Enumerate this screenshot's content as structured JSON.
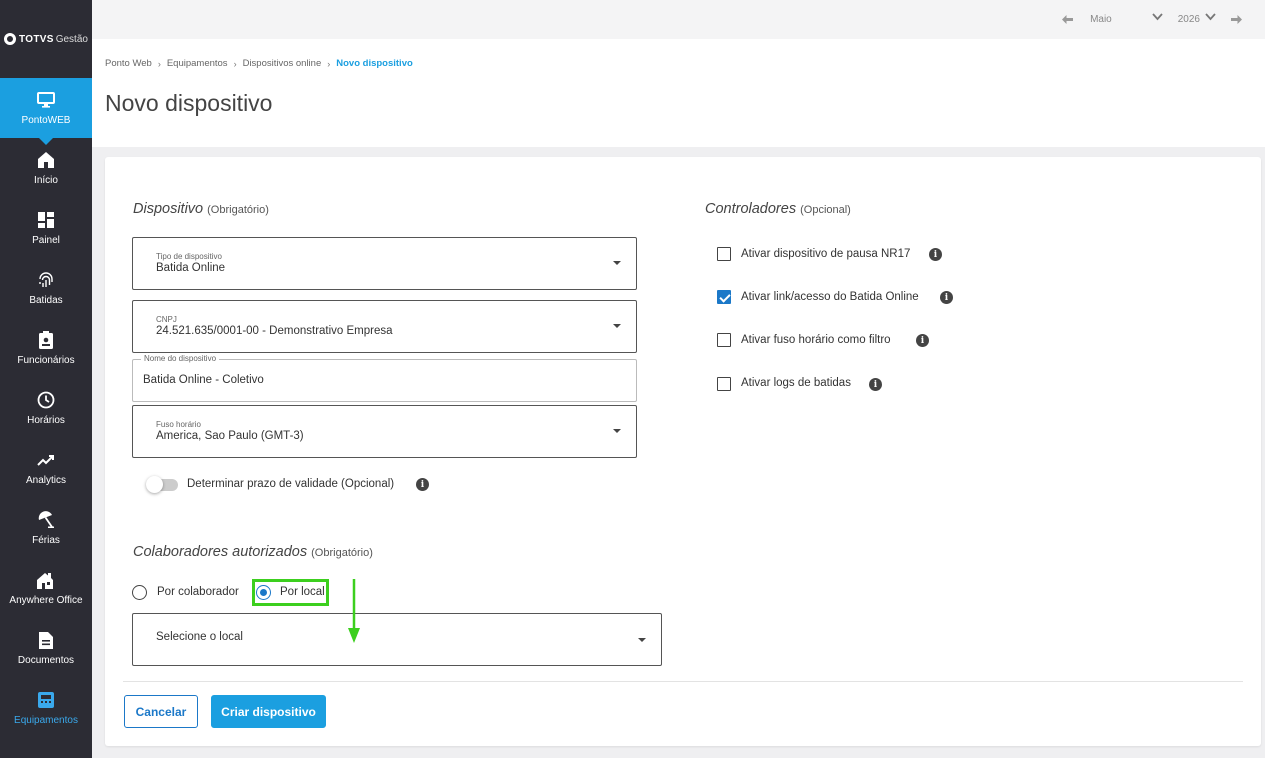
{
  "sidebar": {
    "logo_brand": "TOTVS",
    "logo_product": "Gestão",
    "items": [
      {
        "label": "PontoWEB",
        "icon": "monitor-icon"
      },
      {
        "label": "Início",
        "icon": "home-icon"
      },
      {
        "label": "Painel",
        "icon": "dashboard-icon"
      },
      {
        "label": "Batidas",
        "icon": "fingerprint-icon"
      },
      {
        "label": "Funcionários",
        "icon": "badge-icon"
      },
      {
        "label": "Horários",
        "icon": "clock-icon"
      },
      {
        "label": "Analytics",
        "icon": "trend-icon"
      },
      {
        "label": "Férias",
        "icon": "beach-umbrella-icon"
      },
      {
        "label": "Anywhere Office",
        "icon": "home-office-icon"
      },
      {
        "label": "Documentos",
        "icon": "document-icon"
      },
      {
        "label": "Equipamentos",
        "icon": "equipment-icon"
      }
    ],
    "accent": "#1b9fe0",
    "current_color": "#3aa9ec"
  },
  "topbar": {
    "month": "Maio",
    "year": "2026"
  },
  "breadcrumb": [
    "Ponto Web",
    "Equipamentos",
    "Dispositivos online",
    "Novo dispositivo"
  ],
  "page_title": "Novo dispositivo",
  "device_section": {
    "title": "Dispositivo",
    "qualifier": "(Obrigatório)",
    "device_type": {
      "label": "Tipo de dispositivo",
      "value": "Batida Online"
    },
    "cnpj": {
      "label": "CNPJ",
      "value": "24.521.635/0001-00 - Demonstrativo Empresa"
    },
    "device_name": {
      "label": "Nome do dispositivo",
      "value": "Batida Online - Coletivo"
    },
    "timezone": {
      "label": "Fuso horário",
      "value": "America, Sao Paulo (GMT-3)"
    },
    "validity_toggle": {
      "label": "Determinar prazo de validade (Opcional)",
      "on": false
    }
  },
  "collaborators_section": {
    "title": "Colaboradores autorizados",
    "qualifier": "(Obrigatório)",
    "option_collaborator": "Por colaborador",
    "option_location": "Por local",
    "selected": "Por local",
    "location_placeholder": "Selecione o local"
  },
  "controllers_section": {
    "title": "Controladores",
    "qualifier": "(Opcional)",
    "options": [
      {
        "label": "Ativar dispositivo de pausa NR17",
        "checked": false
      },
      {
        "label": "Ativar link/acesso do Batida Online",
        "checked": true
      },
      {
        "label": "Ativar fuso horário como filtro",
        "checked": false
      },
      {
        "label": "Ativar logs de batidas",
        "checked": false
      }
    ]
  },
  "actions": {
    "cancel": "Cancelar",
    "create": "Criar dispositivo"
  },
  "colors": {
    "highlight": "#3ccf1e",
    "primary": "#1b9fe0",
    "check": "#1b78c8"
  }
}
